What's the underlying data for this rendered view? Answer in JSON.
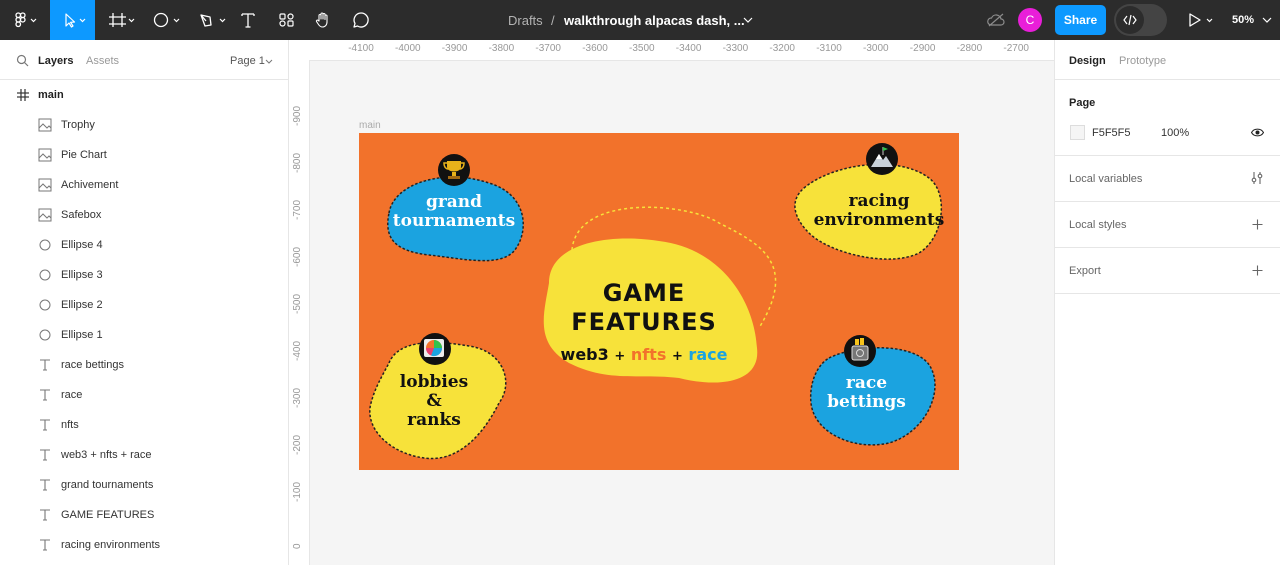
{
  "topbar": {
    "breadcrumb": "Drafts",
    "separator": "/",
    "file_name": "walkthrough alpacas dash, ...",
    "avatar_initial": "C",
    "share_label": "Share",
    "zoom": "50%",
    "colors": {
      "bar": "#2c2c2c",
      "active_tool": "#0d99ff",
      "share": "#0d99ff",
      "avatar": "#e91ed9"
    }
  },
  "left_panel": {
    "tabs": {
      "layers": "Layers",
      "assets": "Assets"
    },
    "page_selector": "Page 1",
    "frame_name": "main",
    "layers": [
      {
        "icon": "image-icon",
        "label": "Trophy"
      },
      {
        "icon": "image-icon",
        "label": "Pie Chart"
      },
      {
        "icon": "image-icon",
        "label": "Achivement"
      },
      {
        "icon": "image-icon",
        "label": "Safebox"
      },
      {
        "icon": "ellipse-icon",
        "label": "Ellipse 4"
      },
      {
        "icon": "ellipse-icon",
        "label": "Ellipse 3"
      },
      {
        "icon": "ellipse-icon",
        "label": "Ellipse 2"
      },
      {
        "icon": "ellipse-icon",
        "label": "Ellipse 1"
      },
      {
        "icon": "text-icon",
        "label": "race bettings"
      },
      {
        "icon": "text-icon",
        "label": "race"
      },
      {
        "icon": "text-icon",
        "label": "nfts"
      },
      {
        "icon": "text-icon",
        "label": "web3 + nfts + race"
      },
      {
        "icon": "text-icon",
        "label": "grand tournaments"
      },
      {
        "icon": "text-icon",
        "label": "GAME FEATURES"
      },
      {
        "icon": "text-icon",
        "label": "racing environments"
      }
    ]
  },
  "rulers": {
    "top": [
      "-4100",
      "-4000",
      "-3900",
      "-3800",
      "-3700",
      "-3600",
      "-3500",
      "-3400",
      "-3300",
      "-3200",
      "-3100",
      "-3000",
      "-2900",
      "-2800",
      "-2700"
    ],
    "left": [
      "-900",
      "-800",
      "-700",
      "-600",
      "-500",
      "-400",
      "-300",
      "-200",
      "-100",
      "0"
    ]
  },
  "canvas": {
    "frame_label": "main",
    "colors": {
      "background": "#f2722b",
      "yellow": "#f7e23a",
      "blue": "#1ba3e0",
      "nfts": "#f2722b",
      "race": "#1ba3e0"
    },
    "title_line1": "GAME",
    "title_line2": "FEATURES",
    "subtitle": {
      "web3": "web3",
      "plus1": "+",
      "nfts": "nfts",
      "plus2": "+",
      "race": "race"
    },
    "blob_grand": {
      "line1": "grand",
      "line2": "tournaments"
    },
    "blob_racing": {
      "line1": "racing",
      "line2": "environments"
    },
    "blob_lobbies": {
      "line1": "lobbies",
      "line2": "&",
      "line3": "ranks"
    },
    "blob_bettings": {
      "line1": "race",
      "line2": "bettings"
    }
  },
  "right_panel": {
    "tabs": {
      "design": "Design",
      "prototype": "Prototype"
    },
    "page_heading": "Page",
    "page_color": "F5F5F5",
    "page_opacity": "100%",
    "local_variables": "Local variables",
    "local_styles": "Local styles",
    "export": "Export"
  }
}
